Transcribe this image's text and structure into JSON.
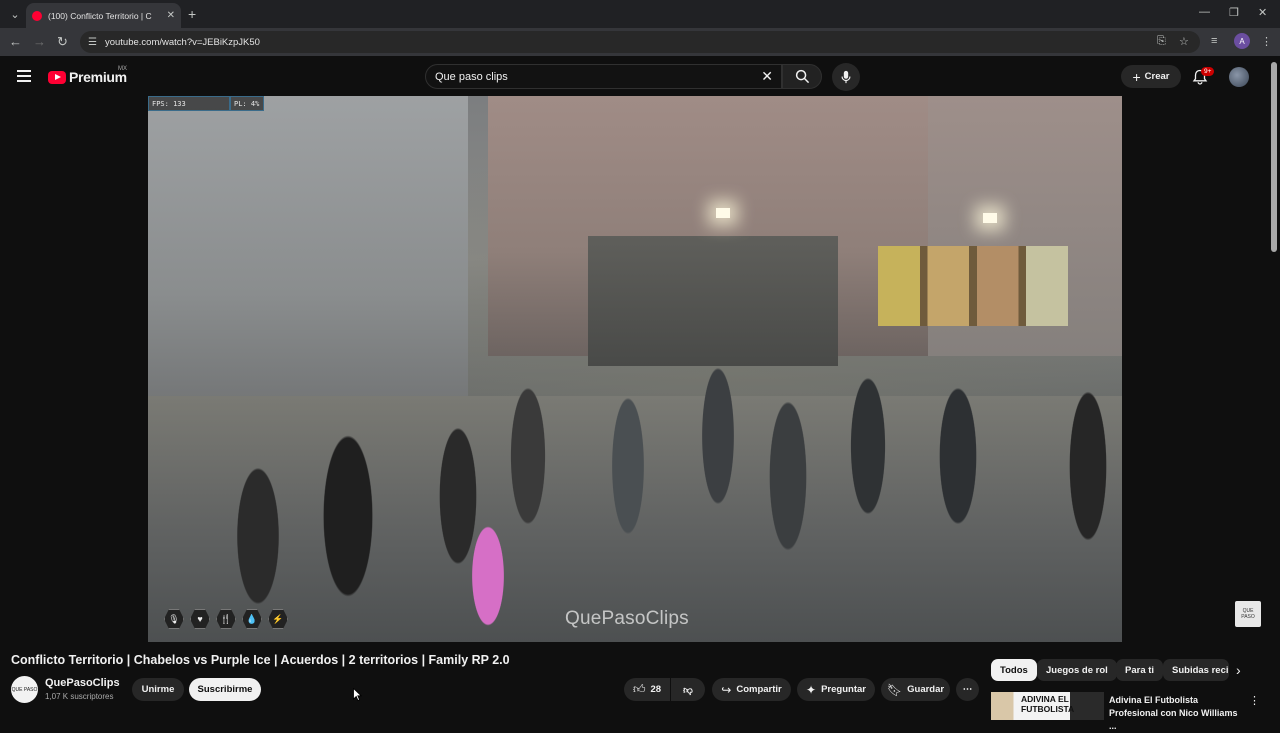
{
  "browser": {
    "tab_title": "(100) Conflicto Territorio | C",
    "url": "youtube.com/watch?v=JEBiKzpJK50",
    "profile_initial": "A"
  },
  "masthead": {
    "logo_text": "Premium",
    "country_code": "MX",
    "search_value": "Que paso clips",
    "create_label": "Crear",
    "notification_count": "9+"
  },
  "video": {
    "fps_label": "FPS: 133",
    "pl_label": "PL: 4%",
    "watermark": "QuePasoClips",
    "hud_icons": [
      "mic-icon",
      "heart-icon",
      "food-icon",
      "water-icon",
      "energy-icon"
    ]
  },
  "info": {
    "title": "Conflicto Territorio | Chabelos vs Purple Ice | Acuerdos | 2 territorios | Family RP 2.0",
    "channel_name": "QuePasoClips",
    "subscribers": "1,07 K suscriptores",
    "join_label": "Unirme",
    "subscribe_label": "Suscribirme",
    "likes": "28",
    "share_label": "Compartir",
    "ask_label": "Preguntar",
    "save_label": "Guardar"
  },
  "sidebar": {
    "chips": [
      "Todos",
      "Juegos de rol",
      "Para ti",
      "Subidas reci"
    ],
    "rec_thumb_text": "ADIVINA EL FUTBOLISTA",
    "rec_title": "Adivina El Futbolista Profesional con Nico Williams ..."
  },
  "colors": {
    "background": "#0f0f0f",
    "brand_red": "#ff0033",
    "chip_active": "#f1f1f1"
  }
}
